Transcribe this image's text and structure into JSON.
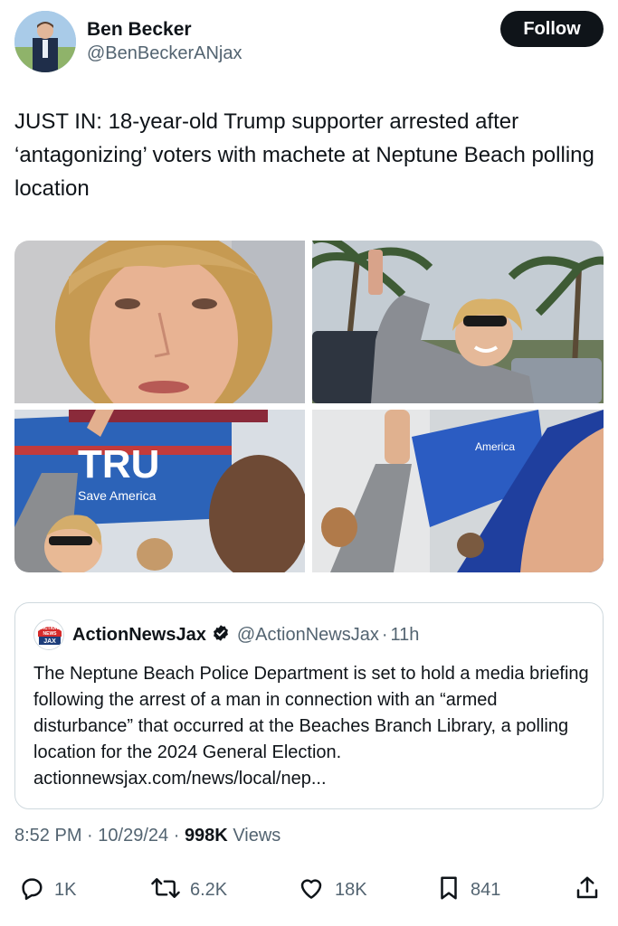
{
  "author": {
    "display_name": "Ben Becker",
    "handle": "@BenBeckerANjax",
    "follow_label": "Follow"
  },
  "tweet": {
    "text": "JUST IN: 18-year-old Trump supporter arrested after ‘antagonizing’ voters with machete at Neptune Beach polling location"
  },
  "media": {
    "flag_text_1": "TRU",
    "flag_text_2": "Save America",
    "flag_text_3": "America"
  },
  "quote": {
    "logo_text_1": "ACTION",
    "logo_text_2": "NEWS",
    "logo_text_3": "JAX",
    "name": "ActionNewsJax",
    "handle": "@ActionNewsJax",
    "separator": "·",
    "time": "11h",
    "body": "The Neptune Beach Police Department is set to hold a media briefing following the arrest of a man in connection with an “armed disturbance” that occurred at the Beaches Branch Library, a polling location for the 2024 General Election. actionnewsjax.com/news/local/nep..."
  },
  "meta": {
    "time": "8:52 PM",
    "separator": "·",
    "date": "10/29/24",
    "views_count": "998K",
    "views_label": "Views"
  },
  "actions": {
    "reply_count": "1K",
    "retweet_count": "6.2K",
    "like_count": "18K",
    "bookmark_count": "841"
  },
  "colors": {
    "text": "#0f1419",
    "secondary": "#536471",
    "border": "#cfd9de",
    "verified": "#0f1419",
    "follow_bg": "#0f1419"
  },
  "icons": [
    "reply-icon",
    "retweet-icon",
    "like-icon",
    "bookmark-icon",
    "share-icon",
    "verified-badge-icon"
  ]
}
